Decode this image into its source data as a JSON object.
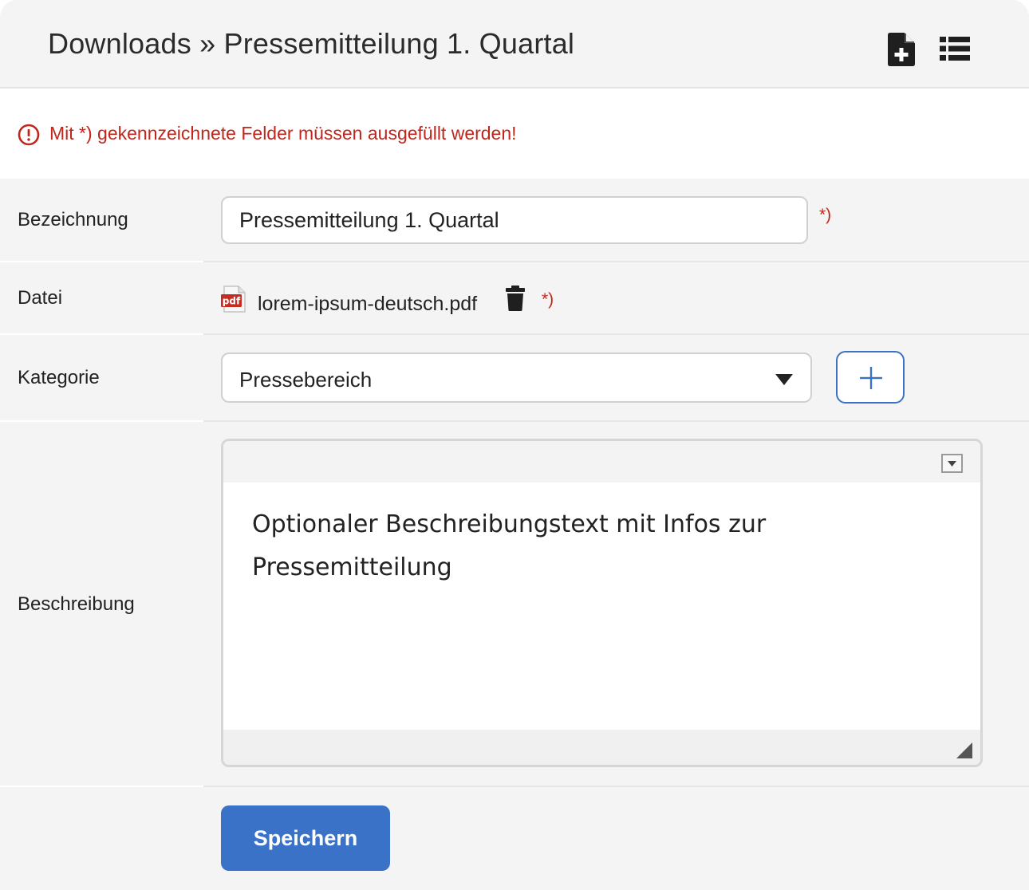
{
  "header": {
    "title": "Downloads » Pressemitteilung 1. Quartal",
    "icons": [
      "new-file-icon",
      "list-icon"
    ]
  },
  "notice": {
    "text": "Mit *) gekennzeichnete Felder müssen ausgefüllt werden!",
    "color": "#c0261b",
    "icon": "alert-circle-icon"
  },
  "form": {
    "required_marker": "*)",
    "bezeichnung": {
      "label": "Bezeichnung",
      "value": "Pressemitteilung 1. Quartal"
    },
    "datei": {
      "label": "Datei",
      "file_name": "lorem-ipsum-deutsch.pdf",
      "file_icon": "pdf-file-icon",
      "delete_icon": "trash-icon"
    },
    "kategorie": {
      "label": "Kategorie",
      "selected": "Pressebereich",
      "add_icon": "plus-icon"
    },
    "beschreibung": {
      "label": "Beschreibung",
      "text": "Optionaler Beschreibungstext mit Infos zur Pressemitteilung"
    },
    "save_label": "Speichern"
  },
  "colors": {
    "accent": "#3a72c8",
    "error": "#c0261b",
    "background": "#f4f4f4"
  }
}
